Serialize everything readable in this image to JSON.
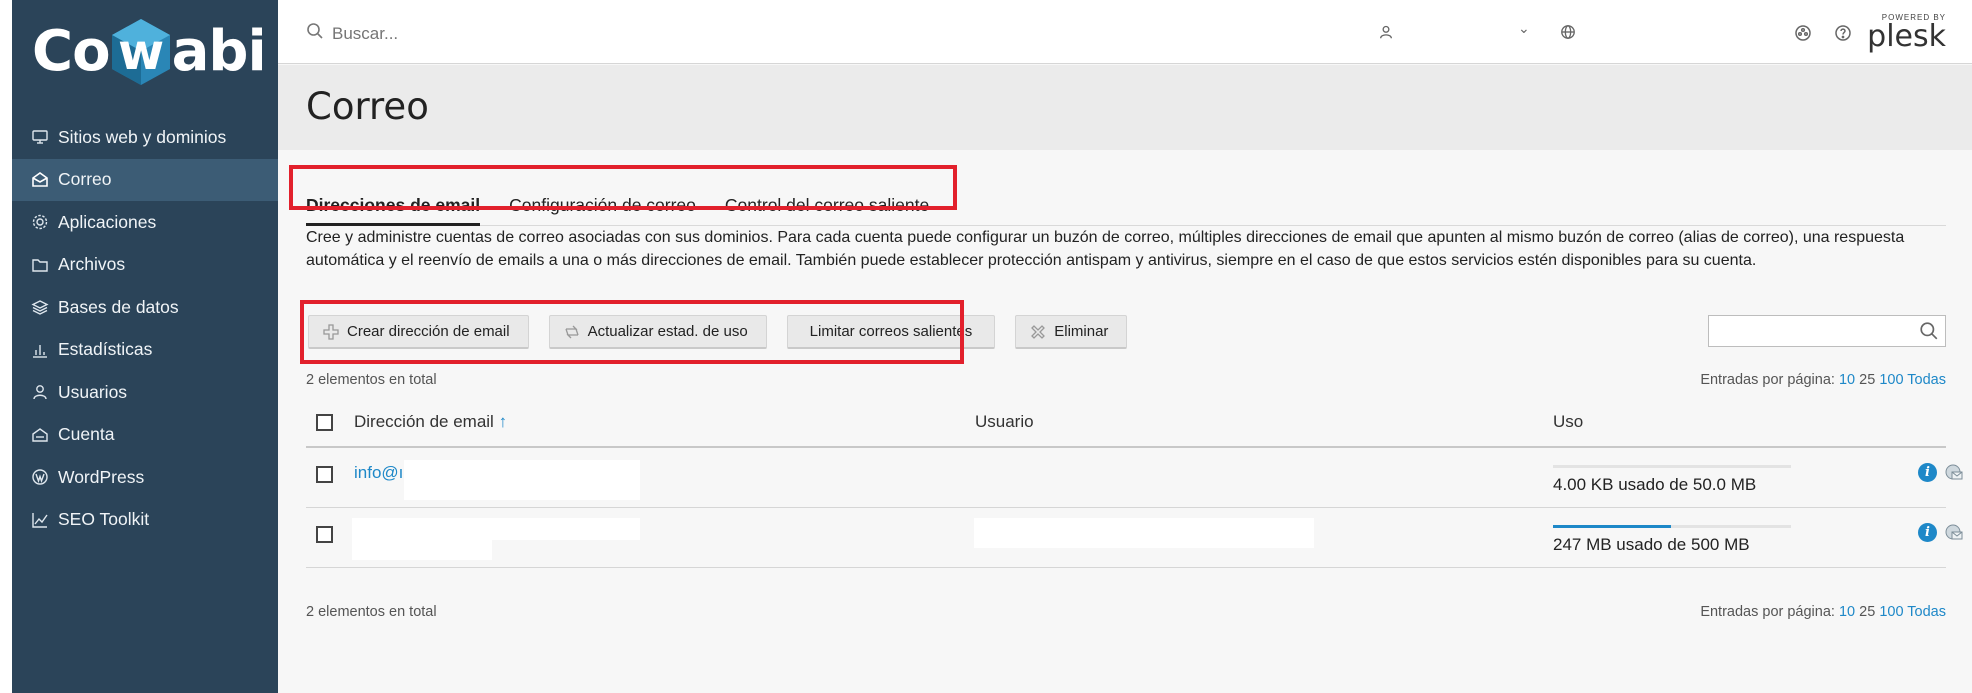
{
  "brand": {
    "logo_left": "Co",
    "logo_mid": "w",
    "logo_right": "abi"
  },
  "sidebar": {
    "items": [
      {
        "label": "Sitios web y dominios",
        "icon": "monitor-icon"
      },
      {
        "label": "Correo",
        "icon": "envelope-open-icon",
        "active": true
      },
      {
        "label": "Aplicaciones",
        "icon": "gear-icon"
      },
      {
        "label": "Archivos",
        "icon": "folder-icon"
      },
      {
        "label": "Bases de datos",
        "icon": "layers-icon"
      },
      {
        "label": "Estadísticas",
        "icon": "bar-chart-icon"
      },
      {
        "label": "Usuarios",
        "icon": "user-icon"
      },
      {
        "label": "Cuenta",
        "icon": "account-icon"
      },
      {
        "label": "WordPress",
        "icon": "wordpress-icon"
      },
      {
        "label": "SEO Toolkit",
        "icon": "seo-chart-icon"
      }
    ],
    "collapse_glyph": "‹"
  },
  "topbar": {
    "search_placeholder": "Buscar...",
    "chevron": "⌄",
    "powered_by": "POWERED BY",
    "plesk": "plesk"
  },
  "page": {
    "title": "Correo"
  },
  "tabs": [
    {
      "label": "Direcciones de email",
      "active": true
    },
    {
      "label": "Configuración de correo"
    },
    {
      "label": "Control del correo saliente"
    }
  ],
  "description": "Cree y administre cuentas de correo asociadas con sus dominios. Para cada cuenta puede configurar un buzón de correo, múltiples direcciones de email que apunten al mismo buzón de correo (alias de correo), una respuesta automática y el reenvío de emails a una o más direcciones de email. También puede establecer protección antispam y antivirus, siempre en el caso de que estos servicios estén disponibles para su cuenta.",
  "toolbar": {
    "create": "Crear dirección de email",
    "update": "Actualizar estad. de uso",
    "limit": "Limitar correos salientes",
    "delete": "Eliminar"
  },
  "list": {
    "total_top": "2 elementos en total",
    "total_bottom": "2 elementos en total",
    "per_page_label": "Entradas por página:",
    "per_page_options": [
      "10",
      "25",
      "100",
      "Todas"
    ],
    "columns": {
      "email": "Dirección de email",
      "sort_arrow": "↑",
      "user": "Usuario",
      "usage": "Uso"
    },
    "rows": [
      {
        "email": "info@ı",
        "usage": "4.00 KB usado de 50.0 MB",
        "fraction": 0.0
      },
      {
        "email": "",
        "usage": "247 MB usado de 500 MB",
        "fraction": 0.494
      }
    ]
  },
  "colors": {
    "sidebar": "#2b4459",
    "sidebar_active": "#3c5c75",
    "accent": "#1e88c8",
    "highlight": "#e2202c"
  }
}
